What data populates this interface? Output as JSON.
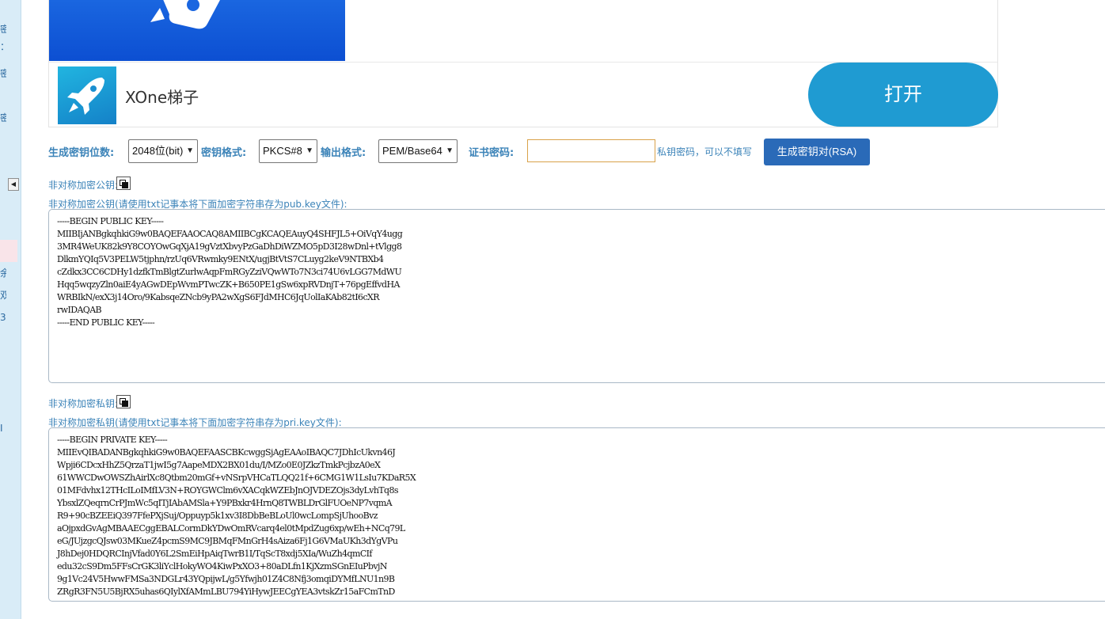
{
  "sidebar": {
    "glyphs": [
      "密",
      "：",
      "密",
      "密",
      "余",
      "双",
      "3",
      "I"
    ]
  },
  "ad": {
    "app_name": "XOne梯子",
    "open_label": "打开"
  },
  "form": {
    "bits_label": "生成密钥位数:",
    "bits_value": "2048位(bit)",
    "format_label": "密钥格式:",
    "format_value": "PKCS#8",
    "output_label": "输出格式:",
    "output_value": "PEM/Base64",
    "password_label": "证书密码:",
    "password_value": "",
    "password_hint": "私钥密码，可以不填写",
    "generate_label": "生成密钥对(RSA)"
  },
  "public_key": {
    "title": "非对称加密公钥:",
    "hint": "非对称加密公钥(请使用txt记事本将下面加密字符串存为pub.key文件):",
    "content": "-----BEGIN PUBLIC KEY-----\nMIIBIjANBgkqhkiG9w0BAQEFAAOCAQ8AMIIBCgKCAQEAuyQ4SHFJL5+OiVqY4ugg\n3MR4WeUK82k9Y8COYOwGqXjA19gVztXbvyPzGaDhDiWZMO5pD3I28wDnl+tVlgg8\nDlkmYQIq5V3PELW5tjphn/rzUq6VRwmky9ENtX/ugjBtVtS7CLuyg2keV9NTBXb4\ncZdkx3CC6CDHy1dzfkTmBlgtZurlwAqpFmRGyZziVQwWTo7N3ci74U6vLGG7MdWU\nHqq5wqzyZln0aiE4yAGwDEpWvmPTwcZK+B650PE1gSw6xpRVDnjT+76pgEffvdHA\nWRBIkN/exX3j14Oro/9KabsqeZNcb9yPA2wXgS6FJdMHC6JqUolIaKAb82tI6cXR\nrwIDAQAB\n-----END PUBLIC KEY-----"
  },
  "private_key": {
    "title": "非对称加密私钥:",
    "hint": "非对称加密私钥(请使用txt记事本将下面加密字符串存为pri.key文件):",
    "content": "-----BEGIN PRIVATE KEY-----\nMIIEvQIBADANBgkqhkiG9w0BAQEFAASCBKcwggSjAgEAAoIBAQC7JDhIcUkvn46J\nWpji6CDcxHhZ5QrzaT1jwI5g7AapeMDX2BX01du/I/MZo0E0JZkzTmkPcjbzA0eX\n61WWCDwOWSZhAirlXc8Qtbm20mGf+vNSrpVHCaTLQQ21f+6CMG1W1LsIu7KDaR5X\n01MFdvhx12THcILoIMfLV3N+ROYGWClm6vXACqkWZEbJnOJVDEZOjs3dyLvhTq8s\nYbsxlZQeqrnCrPJmWc5qITjIAbAMSla+Y9PBxkr4HrnQ8TWBLDrGlFUOeNP7vqmA\nR9+90cBZEEiQ397FfePXjSuj/Oppuyp5k1xv3I8DbBeBLoUl0wcLompSjUhooBvz\naOjpxdGvAgMBAAECggEBALCormDkYDwOmRVcarq4el0tMpdZug6xp/wEh+NCq79L\neG/JUjzgcQJsw03MKueZ4pcmS9MC9JBMqFMnGrH4sAiza6Fj1G6VMaUKh3dYgVPu\nJ8hDej0HDQRCInjVfad0Y6L2SmEiHpAiqTwrB1I/TqScT8xdj5XIa/WuZh4qmCIf\nedu32cS9Dm5FFsCrGK3liYclHokyWO4KiwPxXO3+80aDLfn1KjXzmSGnEIuPbvjN\n9g1Vc24V5HwwFMSa3NDGLr43YQpijwL/g5Yfwjh01Z4C8Nfj3omqiDYMfLNU1n9B\nZRgR3FN5U5BjRX5uhas6QIylXfAMmLBU794YiHywJEECgYEA3vtskZr15aFCmTnD"
  }
}
